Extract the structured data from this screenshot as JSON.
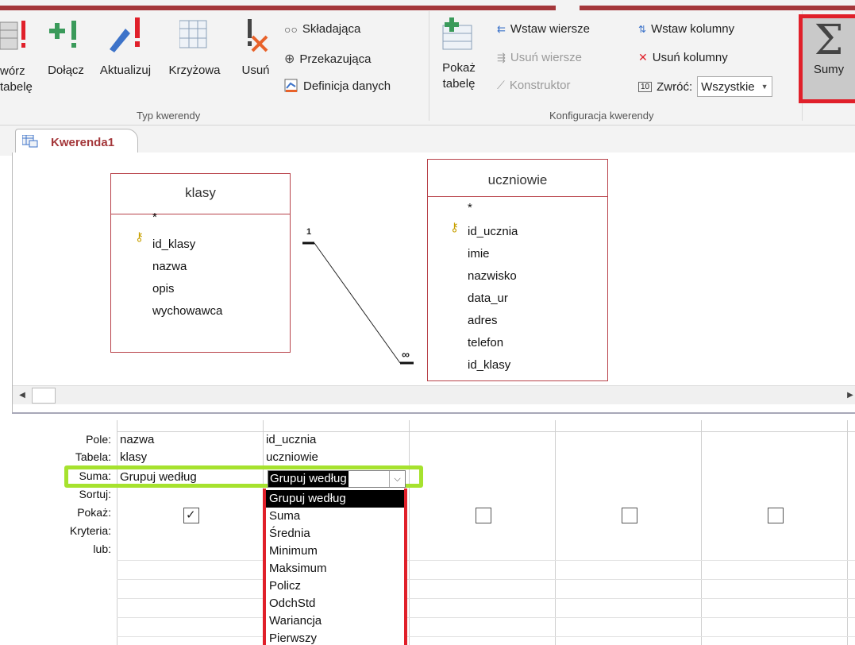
{
  "ribbon": {
    "buttons_large": {
      "create_table": "wórz\ntabelę",
      "append": "Dołącz",
      "update": "Aktualizuj",
      "crosstab": "Krzyżowa",
      "delete": "Usuń",
      "show_table": "Pokaż\ntabelę",
      "totals": "Sumy"
    },
    "buttons_small": {
      "union": "Składająca",
      "pass_through": "Przekazująca",
      "data_definition": "Definicja danych",
      "insert_rows": "Wstaw wiersze",
      "delete_rows": "Usuń wiersze",
      "builder": "Konstruktor",
      "insert_columns": "Wstaw kolumny",
      "delete_columns": "Usuń kolumny",
      "return_label": "Zwróć:",
      "return_value": "Wszystkie"
    },
    "groups": {
      "query_type": "Typ kwerendy",
      "query_setup": "Konfiguracja kwerendy"
    }
  },
  "tab": {
    "title": "Kwerenda1"
  },
  "tables": {
    "klasy": {
      "name": "klasy",
      "fields": [
        "*",
        "id_klasy",
        "nazwa",
        "opis",
        "wychowawca"
      ]
    },
    "uczniowie": {
      "name": "uczniowie",
      "fields": [
        "*",
        "id_ucznia",
        "imie",
        "nazwisko",
        "data_ur",
        "adres",
        "telefon",
        "id_klasy"
      ]
    }
  },
  "relationship": {
    "one": "1",
    "many": "∞"
  },
  "grid": {
    "row_labels": {
      "field": "Pole:",
      "table": "Tabela:",
      "total": "Suma:",
      "sort": "Sortuj:",
      "show": "Pokaż:",
      "criteria": "Kryteria:",
      "or": "lub:"
    },
    "columns": [
      {
        "field": "nazwa",
        "table": "klasy",
        "total": "Grupuj według",
        "show": true
      },
      {
        "field": "id_ucznia",
        "table": "uczniowie",
        "total": "Grupuj według",
        "show": false
      }
    ],
    "total_options": [
      "Grupuj według",
      "Suma",
      "Średnia",
      "Minimum",
      "Maksimum",
      "Policz",
      "OdchStd",
      "Wariancja",
      "Pierwszy"
    ],
    "selected_option": "Grupuj według"
  },
  "colors": {
    "highlight_red": "#e0202a",
    "highlight_green": "#a6e22e",
    "relationship_border": "#b8424a",
    "top_bar": "#a4373a"
  }
}
